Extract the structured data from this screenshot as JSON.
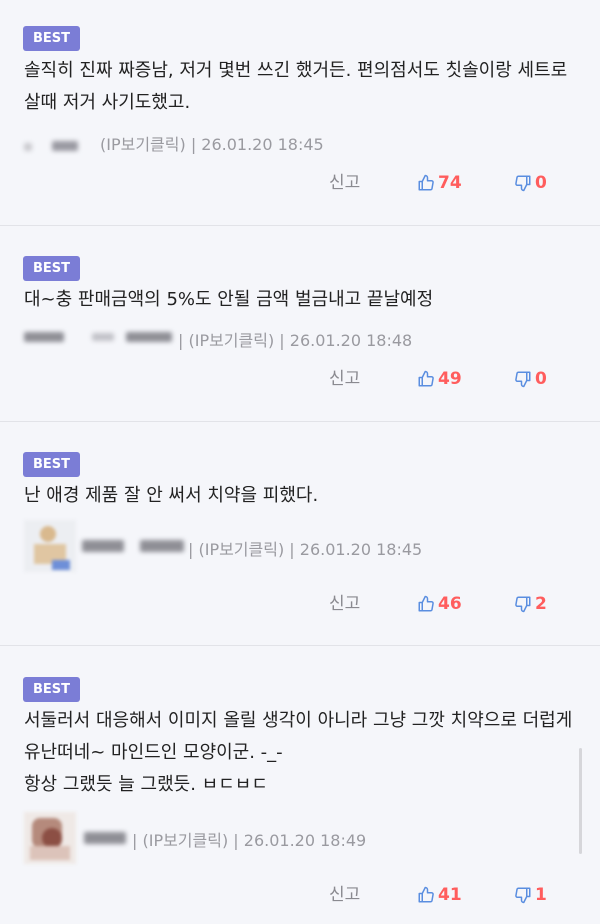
{
  "comments": [
    {
      "badge": "BEST",
      "text": "솔직히 진짜 짜증남, 저거 몇번 쓰긴 했거든. 편의점서도 칫솔이랑 세트로 살때 저거 사기도했고.",
      "meta": "(IP보기클릭) | 26.01.20 18:45",
      "report": "신고",
      "likes": "74",
      "dislikes": "0"
    },
    {
      "badge": "BEST",
      "text": "대~충 판매금액의 5%도 안될 금액 벌금내고 끝날예정",
      "meta": "| (IP보기클릭) | 26.01.20 18:48",
      "report": "신고",
      "likes": "49",
      "dislikes": "0"
    },
    {
      "badge": "BEST",
      "text": "난 애경 제품 잘 안 써서 치약을 피했다.",
      "meta": "| (IP보기클릭) | 26.01.20 18:45",
      "report": "신고",
      "likes": "46",
      "dislikes": "2"
    },
    {
      "badge": "BEST",
      "text": "서둘러서 대응해서 이미지 올릴 생각이 아니라 그냥 그깟 치약으로 더럽게 유난떠네~ 마인드인 모양이군. -_-\n항상 그랬듯 늘 그랬듯. ㅂㄷㅂㄷ",
      "meta": "| (IP보기클릭) | 26.01.20 18:49",
      "report": "신고",
      "likes": "41",
      "dislikes": "1"
    }
  ],
  "icons": {
    "like": "thumbs-up-icon",
    "dislike": "thumbs-down-icon"
  },
  "colors": {
    "badge": "#7b7dd6",
    "count": "#ff5d5d",
    "like_icon": "#5a8ee0",
    "dislike_icon": "#5a8ee0"
  }
}
